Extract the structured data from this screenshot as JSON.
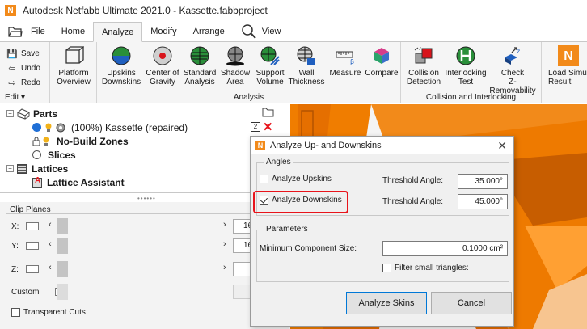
{
  "window": {
    "title": "Autodesk Netfabb Ultimate 2021.0 - Kassette.fabbproject",
    "app_logo": "N"
  },
  "tabs": [
    {
      "label": "File"
    },
    {
      "label": "Home"
    },
    {
      "label": "Analyze"
    },
    {
      "label": "Modify"
    },
    {
      "label": "Arrange"
    },
    {
      "label": "View"
    }
  ],
  "ribbon": {
    "edit": {
      "save": "Save",
      "undo": "Undo",
      "redo": "Redo",
      "edit_label": "Edit ▾"
    },
    "platform_overview": "Platform\nOverview",
    "analysis_buttons": [
      {
        "label": "Upskins\nDownskins"
      },
      {
        "label": "Center of\nGravity"
      },
      {
        "label": "Standard\nAnalysis"
      },
      {
        "label": "Shadow\nArea"
      },
      {
        "label": "Support\nVolume"
      },
      {
        "label": "Wall\nThickness"
      },
      {
        "label": "Measure"
      },
      {
        "label": "Compare"
      }
    ],
    "analysis_group": "Analysis",
    "collision_buttons": [
      {
        "label": "Collision\nDetection"
      },
      {
        "label": "Interlocking\nTest"
      },
      {
        "label": "Check\nZ-Removability"
      }
    ],
    "collision_group": "Collision and Interlocking",
    "load_sim": "Load Simu\nResult"
  },
  "tree": {
    "parts": "Parts",
    "part_item": "(100%) Kassette (repaired)",
    "part_badge": "2",
    "no_build": "No-Build Zones",
    "slices": "Slices",
    "lattices": "Lattices",
    "lattice_assistant": "Lattice Assistant"
  },
  "clip": {
    "title": "Clip Planes",
    "x": "X:",
    "y": "Y:",
    "z": "Z:",
    "x_value": "16",
    "y_value": "16",
    "custom": "Custom",
    "transparent": "Transparent Cuts"
  },
  "dialog": {
    "title": "Analyze Up- and Downskins",
    "angles_legend": "Angles",
    "upskins_label": "Analyze Upskins",
    "upskins_checked": false,
    "upskins_threshold_label": "Threshold Angle:",
    "upskins_threshold": "35.000°",
    "downskins_label": "Analyze Downskins",
    "downskins_checked": true,
    "downskins_threshold_label": "Threshold Angle:",
    "downskins_threshold": "45.000°",
    "params_legend": "Parameters",
    "min_size_label": "Minimum Component Size:",
    "min_size": "0.1000 cm²",
    "filter_label": "Filter small triangles:",
    "analyze_button": "Analyze Skins",
    "cancel_button": "Cancel"
  },
  "colors": {
    "accent_orange": "#f28a1a",
    "highlight_red": "#e8141b",
    "viewport_orange": "#f07d00"
  }
}
